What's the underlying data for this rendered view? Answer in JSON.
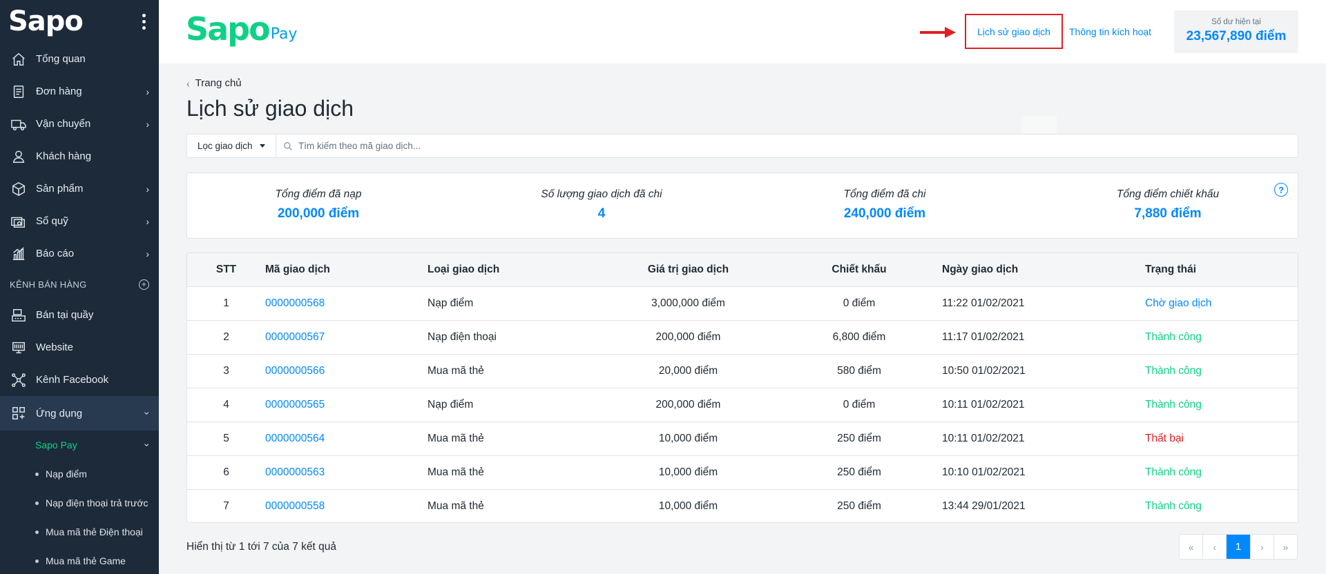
{
  "sidebar": {
    "logo": "Sapo",
    "items": [
      {
        "label": "Tổng quan",
        "icon": "home-icon"
      },
      {
        "label": "Đơn hàng",
        "icon": "order-icon"
      },
      {
        "label": "Vận chuyển",
        "icon": "truck-icon"
      },
      {
        "label": "Khách hàng",
        "icon": "user-icon"
      },
      {
        "label": "Sản phẩm",
        "icon": "box-icon"
      },
      {
        "label": "Sổ quỹ",
        "icon": "cashbook-icon"
      },
      {
        "label": "Báo cáo",
        "icon": "report-icon"
      }
    ],
    "section_label": "KÊNH BÁN HÀNG",
    "channels": [
      {
        "label": "Bán tại quầy",
        "icon": "pos-icon"
      },
      {
        "label": "Website",
        "icon": "website-icon"
      },
      {
        "label": "Kênh Facebook",
        "icon": "facebook-channel-icon"
      }
    ],
    "apps_label": "Ứng dụng",
    "sub_active": "Sapo Pay",
    "sub_items": [
      "Nạp điểm",
      "Nạp điện thoại trả trước",
      "Mua mã thẻ Điện thoại",
      "Mua mã thẻ Game"
    ]
  },
  "header": {
    "brand_main": "Sapo",
    "brand_sub": "Pay",
    "nav_history": "Lịch sử giao dịch",
    "nav_activate": "Thông tin kích hoạt",
    "balance_label": "Số dư hiện tại",
    "balance_value": "23,567,890 điểm",
    "highlight_color": "#e01e25"
  },
  "breadcrumb": "Trang chủ",
  "page_title": "Lịch sử giao dịch",
  "filter": {
    "button_label": "Lọc giao dịch",
    "search_placeholder": "Tìm kiếm theo mã giao dịch..."
  },
  "stats": [
    {
      "label": "Tổng điểm đã nạp",
      "value": "200,000 điểm"
    },
    {
      "label": "Số lượng giao dịch đã chi",
      "value": "4"
    },
    {
      "label": "Tổng điểm đã chi",
      "value": "240,000 điểm"
    },
    {
      "label": "Tổng điểm chiết khấu",
      "value": "7,880 điểm"
    }
  ],
  "table": {
    "headers": [
      "STT",
      "Mã giao dịch",
      "Loại giao dịch",
      "Giá trị giao dịch",
      "Chiết khấu",
      "Ngày giao dịch",
      "Trạng thái"
    ],
    "rows": [
      [
        "1",
        "0000000568",
        "Nạp điểm",
        "3,000,000 điểm",
        "0 điểm",
        "11:22 01/02/2021",
        "Chờ giao dịch"
      ],
      [
        "2",
        "0000000567",
        "Nạp điện thoại",
        "200,000 điểm",
        "6,800 điểm",
        "11:17 01/02/2021",
        "Thành công"
      ],
      [
        "3",
        "0000000566",
        "Mua mã thẻ",
        "20,000 điểm",
        "580 điểm",
        "10:50 01/02/2021",
        "Thành công"
      ],
      [
        "4",
        "0000000565",
        "Nạp điểm",
        "200,000 điểm",
        "0 điểm",
        "10:11 01/02/2021",
        "Thành công"
      ],
      [
        "5",
        "0000000564",
        "Mua mã thẻ",
        "10,000 điểm",
        "250 điểm",
        "10:11 01/02/2021",
        "Thất bại"
      ],
      [
        "6",
        "0000000563",
        "Mua mã thẻ",
        "10,000 điểm",
        "250 điểm",
        "10:10 01/02/2021",
        "Thành công"
      ],
      [
        "7",
        "0000000558",
        "Mua mã thẻ",
        "10,000 điểm",
        "250 điểm",
        "13:44 29/01/2021",
        "Thành công"
      ]
    ]
  },
  "status_colors": {
    "Chờ giao dịch": "#0088ff",
    "Thành công": "#0fd186",
    "Thất bại": "#e01e25"
  },
  "result_text": "Hiển thị từ 1 tới 7 của 7 kết quả",
  "pagination": {
    "first": "«",
    "prev": "‹",
    "current": "1",
    "next": "›",
    "last": "»"
  }
}
